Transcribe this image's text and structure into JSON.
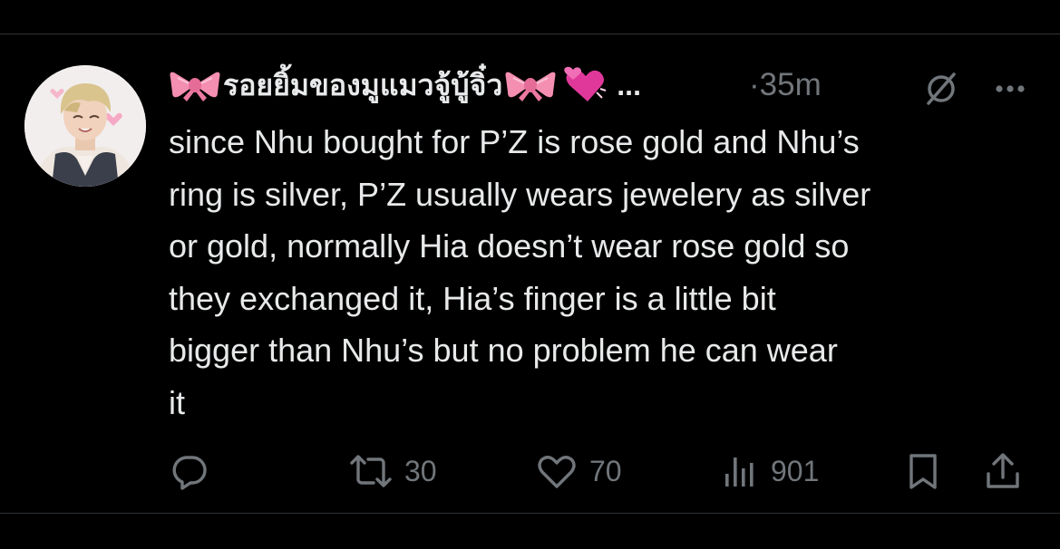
{
  "tweet": {
    "author_name": "รอยยิ้มของมูแมวจู้บู้จิ๋ว",
    "name_truncation": "...",
    "timestamp": "·35m",
    "text": "since Nhu bought for P’Z is rose gold and Nhu’s\nring is silver, P’Z usually wears jewelery as silver\nor gold, normally Hia doesn’t wear rose gold so\nthey exchanged it, Hia’s finger is a little bit\nbigger than Nhu’s but no problem he can wear\nit"
  },
  "icons": {
    "name_emoji_1": "ribbon-emoji",
    "name_emoji_2": "ribbon-emoji",
    "name_emoji_3": "two-hearts-emoji",
    "grok": "grok-icon",
    "more": "more-icon",
    "reply": "reply-icon",
    "retweet": "retweet-icon",
    "like": "heart-icon",
    "views": "views-icon",
    "bookmark": "bookmark-icon",
    "share": "share-icon"
  },
  "actions": {
    "retweets": "30",
    "likes": "70",
    "views": "901"
  },
  "colors": {
    "background": "#000000",
    "text": "#e7e9ea",
    "secondary": "#71767b",
    "divider": "#2f3336",
    "ribbon": "#f48fb1",
    "hearts": "#e0389a"
  }
}
